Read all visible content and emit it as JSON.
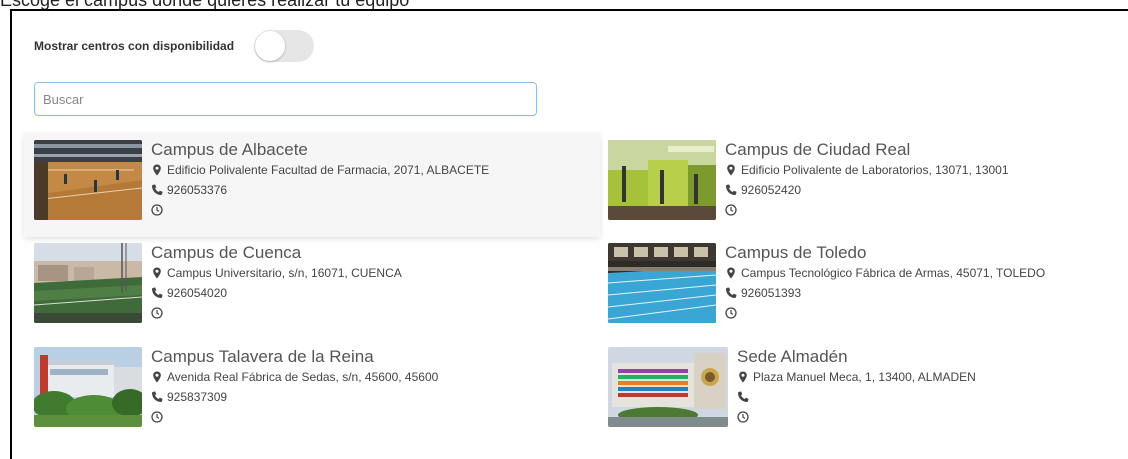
{
  "caption": "Escoge el campus donde quieres realizar tu equipo",
  "filters": {
    "availability_label": "Mostrar centros con disponibilidad",
    "availability_on": false
  },
  "search": {
    "placeholder": "Buscar",
    "value": ""
  },
  "colors": {
    "toggle_off": "#e6e6e6",
    "search_border": "#8fbde8",
    "icon": "#444444",
    "title_text": "#555555"
  },
  "campuses": [
    {
      "name": "Campus de Albacete",
      "address": "Edificio Polivalente Facultad de Farmacia, 2071, ALBACETE",
      "phone": "926053376",
      "hours": "",
      "image": "indoor-sports-court"
    },
    {
      "name": "Campus de Ciudad Real",
      "address": "Edificio Polivalente de Laboratorios, 13071, 13001",
      "phone": "926052420",
      "hours": "",
      "image": "gym-room"
    },
    {
      "name": "Campus de Cuenca",
      "address": "Campus Universitario, s/n, 16071, CUENCA",
      "phone": "926054020",
      "hours": "",
      "image": "outdoor-field"
    },
    {
      "name": "Campus de Toledo",
      "address": "Campus Tecnológico Fábrica de Armas, 45071, TOLEDO",
      "phone": "926051393",
      "hours": "",
      "image": "swimming-pool"
    },
    {
      "name": "Campus Talavera de la Reina",
      "address": "Avenida Real Fábrica de Sedas, s/n, 45600, 45600",
      "phone": "925837309",
      "hours": "",
      "image": "building-garden"
    },
    {
      "name": "Sede Almadén",
      "address": "Plaza Manuel Meca, 1, 13400, ALMADEN",
      "phone": "",
      "hours": "",
      "image": "building-facade"
    }
  ]
}
